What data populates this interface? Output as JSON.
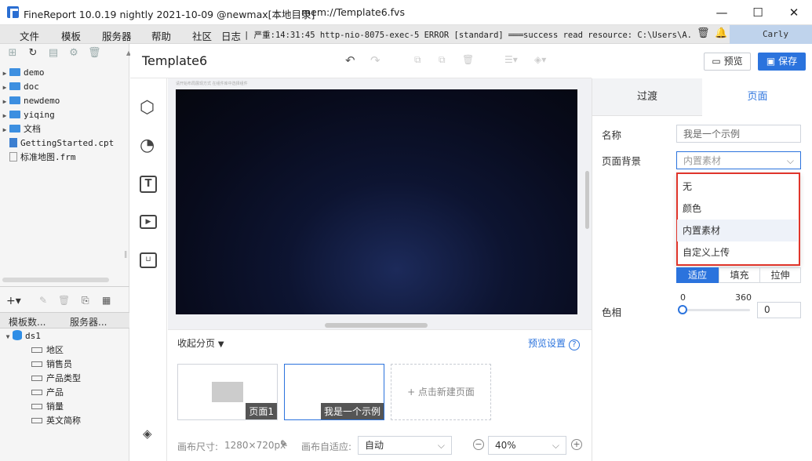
{
  "titlebar": {
    "title": "FineReport 10.0.19 nightly 2021-10-09 @newmax[本地目录]",
    "path": "mem://Template6.fvs",
    "minimize": "—",
    "maximize": "☐",
    "close": "✕"
  },
  "menubar": {
    "items": [
      "文件",
      "模板",
      "服务器",
      "帮助",
      "社区"
    ],
    "log_label": "日志",
    "log_text": "| 严重:14:31:45 http-nio-8075-exec-5 ERROR [standard] ═══success read resource: C:\\Users\\A...",
    "user": "Carly"
  },
  "sidebar": {
    "tree": [
      {
        "name": "demo",
        "type": "folder"
      },
      {
        "name": "doc",
        "type": "folder"
      },
      {
        "name": "newdemo",
        "type": "folder"
      },
      {
        "name": "yiqing",
        "type": "folder"
      },
      {
        "name": "文档",
        "type": "folder"
      },
      {
        "name": "GettingStarted.cpt",
        "type": "cpt"
      },
      {
        "name": "标准地图.frm",
        "type": "frm"
      }
    ],
    "tabs": [
      "模板数...",
      "服务器..."
    ],
    "ds_name": "ds1",
    "fields": [
      "地区",
      "销售员",
      "产品类型",
      "产品",
      "销量",
      "英文简称"
    ]
  },
  "editor": {
    "template_name": "Template6",
    "preview_label": "预览",
    "save_label": "保存",
    "canvas_caption": "请开始布局展现方式 在组件库中选择组件"
  },
  "pages": {
    "collapse_label": "收起分页",
    "preview_settings": "预览设置",
    "page1": "页面1",
    "page2": "我是一个示例",
    "new_page": "+ 点击新建页面"
  },
  "statusbar": {
    "canvas_size_label": "画布尺寸:",
    "canvas_size_value": "1280×720px",
    "adaptive_label": "画布自适应:",
    "adaptive_value": "自动",
    "zoom_value": "40%"
  },
  "rightpanel": {
    "tabs": [
      "过渡",
      "页面"
    ],
    "name_label": "名称",
    "name_value": "我是一个示例",
    "bg_label": "页面背景",
    "bg_value": "内置素材",
    "dropdown_options": [
      "无",
      "颜色",
      "内置素材",
      "自定义上传"
    ],
    "fit_options": [
      "适应",
      "填充",
      "拉伸"
    ],
    "hue_label": "色相",
    "hue_min": "0",
    "hue_max": "360",
    "hue_value": "0"
  },
  "colors": {
    "accent": "#2b73dd",
    "highlight_border": "#e0352b"
  }
}
